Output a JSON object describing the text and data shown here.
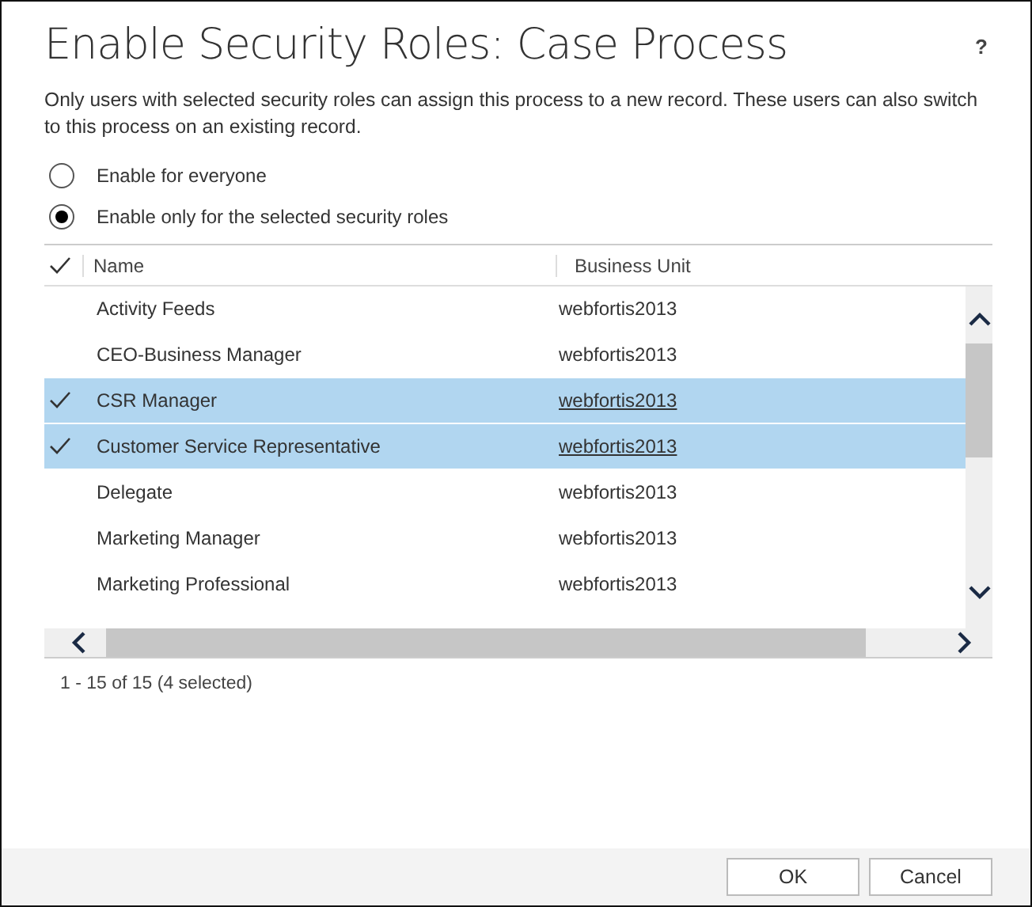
{
  "dialog": {
    "title": "Enable Security Roles: Case Process",
    "help": "?",
    "description": "Only users with selected security roles can assign this process to a new record. These users can also switch to this process on an existing record."
  },
  "options": [
    {
      "label": "Enable for everyone",
      "selected": false
    },
    {
      "label": "Enable only for the selected security roles",
      "selected": true
    }
  ],
  "table": {
    "columns": [
      "Name",
      "Business Unit"
    ],
    "rows": [
      {
        "name": "Activity Feeds",
        "business_unit": "webfortis2013",
        "selected": false
      },
      {
        "name": "CEO-Business Manager",
        "business_unit": "webfortis2013",
        "selected": false
      },
      {
        "name": "CSR Manager",
        "business_unit": "webfortis2013",
        "selected": true
      },
      {
        "name": "Customer Service Representative",
        "business_unit": "webfortis2013",
        "selected": true
      },
      {
        "name": "Delegate",
        "business_unit": "webfortis2013",
        "selected": false
      },
      {
        "name": "Marketing Manager",
        "business_unit": "webfortis2013",
        "selected": false
      },
      {
        "name": "Marketing Professional",
        "business_unit": "webfortis2013",
        "selected": false
      }
    ]
  },
  "record_count": "1 - 15 of 15 (4 selected)",
  "buttons": [
    "OK",
    "Cancel"
  ]
}
